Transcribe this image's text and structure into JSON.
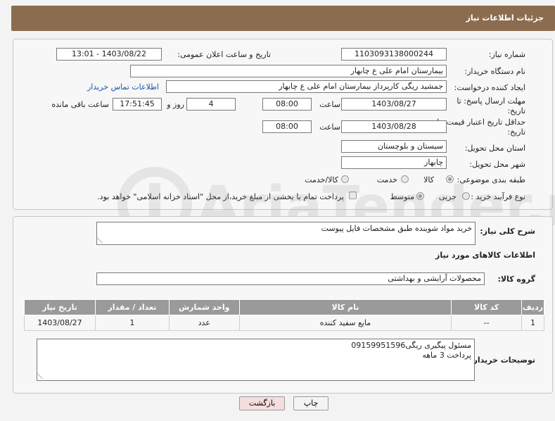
{
  "header": {
    "title": "جزئیات اطلاعات نیاز"
  },
  "form": {
    "need_number": {
      "label": "شماره نیاز:",
      "value": "1103093138000244"
    },
    "announce_datetime": {
      "label": "تاریخ و ساعت اعلان عمومی:",
      "value": "1403/08/22 - 13:01"
    },
    "buyer_org": {
      "label": "نام دستگاه خریدار:",
      "value": "بیمارستان امام علی  ع  چابهار"
    },
    "creator": {
      "label": "ایجاد کننده درخواست:",
      "value": "جمشید ریگی کارپرداز بیمارستان امام علی  ع  چابهار",
      "contact_link": "اطلاعات تماس خریدار"
    },
    "reply_deadline": {
      "label_line1": "مهلت ارسال پاسخ: تا",
      "label_line2": "تاریخ:",
      "date": "1403/08/27",
      "time_label": "ساعت",
      "time": "08:00",
      "days": "4",
      "days_label": "روز و",
      "remaining": "17:51:45",
      "remaining_label": "ساعت باقی مانده"
    },
    "price_validity": {
      "label_line1": "حداقل تاریخ اعتبار قیمت: تا",
      "label_line2": "تاریخ:",
      "date": "1403/08/28",
      "time_label": "ساعت",
      "time": "08:00"
    },
    "province": {
      "label": "استان محل تحویل:",
      "value": "سیستان و بلوچستان"
    },
    "city": {
      "label": "شهر محل تحویل:",
      "value": "چابهار"
    },
    "category": {
      "label": "طبقه بندی موضوعی:",
      "options": [
        "کالا",
        "خدمت",
        "کالا/خدمت"
      ],
      "selected": "کالا"
    },
    "purchase_type": {
      "label": "نوع فرآیند خرید :",
      "options": [
        "جزیی",
        "متوسط"
      ],
      "selected": "متوسط",
      "treasury_note": "پرداخت تمام یا بخشی از مبلغ خرید،از محل \"اسناد خزانه اسلامی\" خواهد بود."
    }
  },
  "description": {
    "label": "شرح کلی نیاز:",
    "value": "خرید مواد شوینده طبق مشخصات فایل پیوست"
  },
  "goods_section": {
    "title": "اطلاعات کالاهای مورد نیاز"
  },
  "goods_group": {
    "label": "گروه کالا:",
    "value": "محصولات آرایشی و بهداشتی"
  },
  "table": {
    "headers": [
      "ردیف",
      "کد کالا",
      "نام کالا",
      "واحد شمارش",
      "تعداد / مقدار",
      "تاریخ نیاز"
    ],
    "rows": [
      [
        "1",
        "--",
        "مایع سفید کننده",
        "عدد",
        "1",
        "1403/08/27"
      ]
    ]
  },
  "buyer_notes": {
    "label": "توضیحات خریدار:",
    "lines": [
      "مسئول پیگیری ریگی09159951596",
      "پرداخت 3 ماهه"
    ]
  },
  "buttons": {
    "print": "چاپ",
    "back": "بازگشت"
  },
  "watermark": {
    "text": "AriaTender.net"
  },
  "colors": {
    "header": "#8c6c4f",
    "table_header": "#9a9a9a",
    "link": "#1a53a8",
    "back_button": "#f6dede"
  }
}
